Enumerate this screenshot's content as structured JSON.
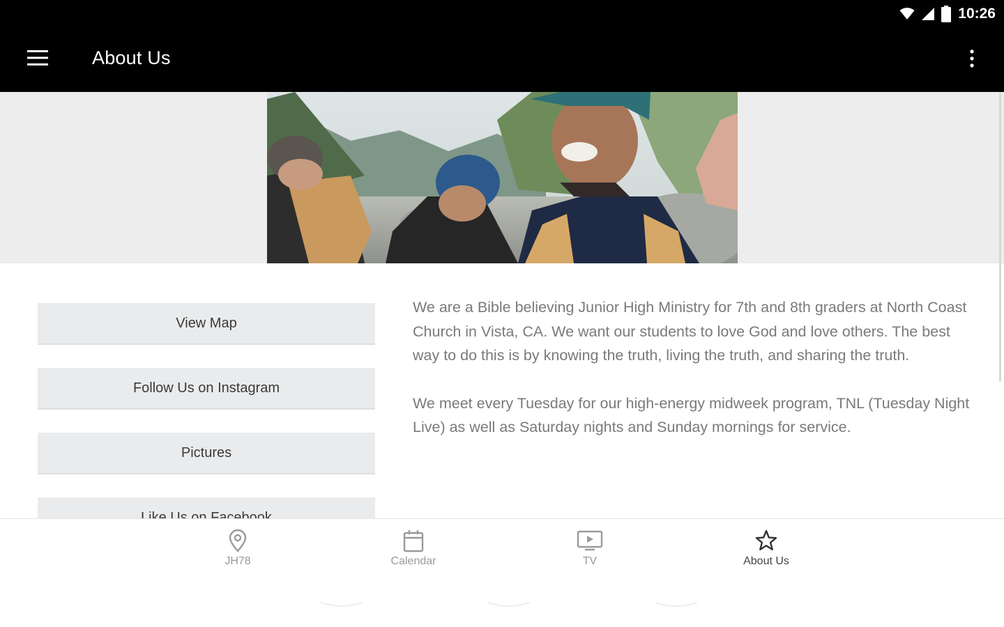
{
  "status_bar": {
    "time": "10:26",
    "icons": [
      "wifi-icon",
      "cell-signal-icon",
      "battery-icon"
    ]
  },
  "app_bar": {
    "title": "About Us",
    "menu_icon": "hamburger-menu-icon",
    "overflow_icon": "more-vert-icon"
  },
  "hero": {
    "image": "hero-photo"
  },
  "actions": [
    {
      "label": "View Map"
    },
    {
      "label": "Follow Us on Instagram"
    },
    {
      "label": "Pictures"
    },
    {
      "label": "Like Us on Facebook"
    }
  ],
  "about": {
    "paragraphs": [
      "We are a Bible believing Junior High Ministry for 7th and 8th graders at North Coast Church in Vista, CA. We want our students to love God and love others. The best way to do this is by knowing the truth, living the truth, and sharing the truth.",
      "We meet every Tuesday for our high-energy midweek program, TNL (Tuesday Night Live) as well as Saturday nights and Sunday mornings for service."
    ]
  },
  "bottom_nav": {
    "items": [
      {
        "label": "JH78",
        "icon": "location-pin-icon",
        "active": false
      },
      {
        "label": "Calendar",
        "icon": "calendar-icon",
        "active": false
      },
      {
        "label": "TV",
        "icon": "tv-play-icon",
        "active": false
      },
      {
        "label": "About Us",
        "icon": "star-icon",
        "active": true
      }
    ]
  },
  "colors": {
    "app_bar": "#000000",
    "hero_band": "#ededee",
    "button_bg": "#eaebec",
    "body_text": "#7a7a7a"
  }
}
